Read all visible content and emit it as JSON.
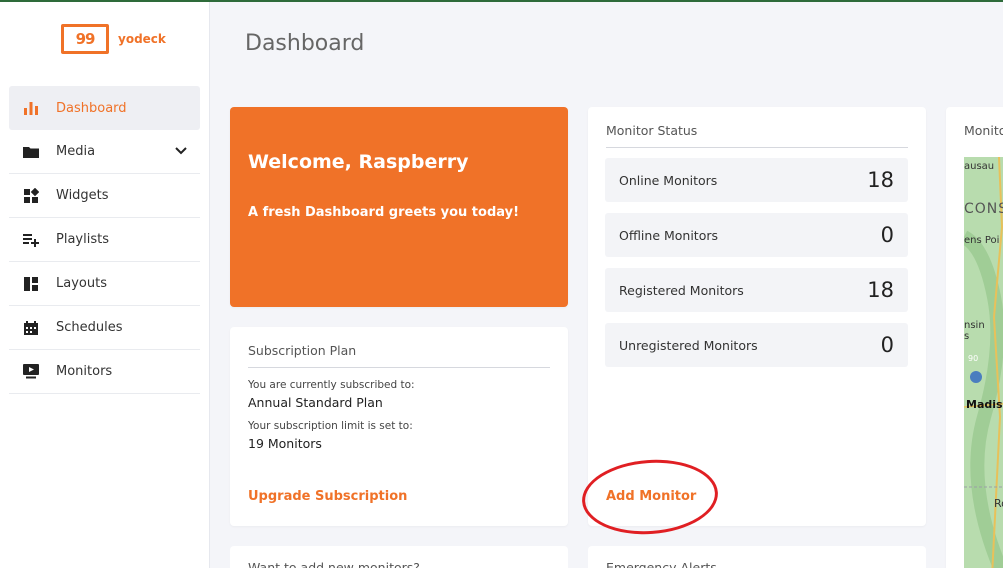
{
  "app": {
    "logo_text": "yodeck",
    "logo_mark": "99"
  },
  "sidebar": {
    "items": [
      {
        "label": "Dashboard",
        "icon": "bar-chart-icon",
        "active": true
      },
      {
        "label": "Media",
        "icon": "folder-icon"
      },
      {
        "label": "Widgets",
        "icon": "widgets-icon"
      },
      {
        "label": "Playlists",
        "icon": "playlist-add-icon"
      },
      {
        "label": "Layouts",
        "icon": "layout-icon"
      },
      {
        "label": "Schedules",
        "icon": "calendar-icon"
      },
      {
        "label": "Monitors",
        "icon": "monitor-play-icon"
      }
    ]
  },
  "page": {
    "title": "Dashboard"
  },
  "welcome": {
    "heading": "Welcome, Raspberry",
    "subtext": "A fresh Dashboard greets you today!"
  },
  "subscription": {
    "title": "Subscription Plan",
    "subscribed_label": "You are currently subscribed to:",
    "plan_name": "Annual Standard Plan",
    "limit_label": "Your subscription limit is set to:",
    "limit_value": "19 Monitors",
    "upgrade_link": "Upgrade Subscription"
  },
  "monitor_status": {
    "title": "Monitor Status",
    "rows": [
      {
        "label": "Online Monitors",
        "value": "18"
      },
      {
        "label": "Offline Monitors",
        "value": "0"
      },
      {
        "label": "Registered Monitors",
        "value": "18"
      },
      {
        "label": "Unregistered Monitors",
        "value": "0"
      }
    ],
    "add_link": "Add Monitor"
  },
  "map_card": {
    "title": "Monito",
    "labels": [
      "ausau",
      "CONS",
      "ens Poi",
      "nsin",
      "s",
      "90",
      "Madis",
      "Ro"
    ]
  },
  "bottom_cards": [
    "Want to add new monitors?",
    "Emergency Alerts"
  ],
  "colors": {
    "brand": "#f07228",
    "annotation": "#e01f23"
  }
}
